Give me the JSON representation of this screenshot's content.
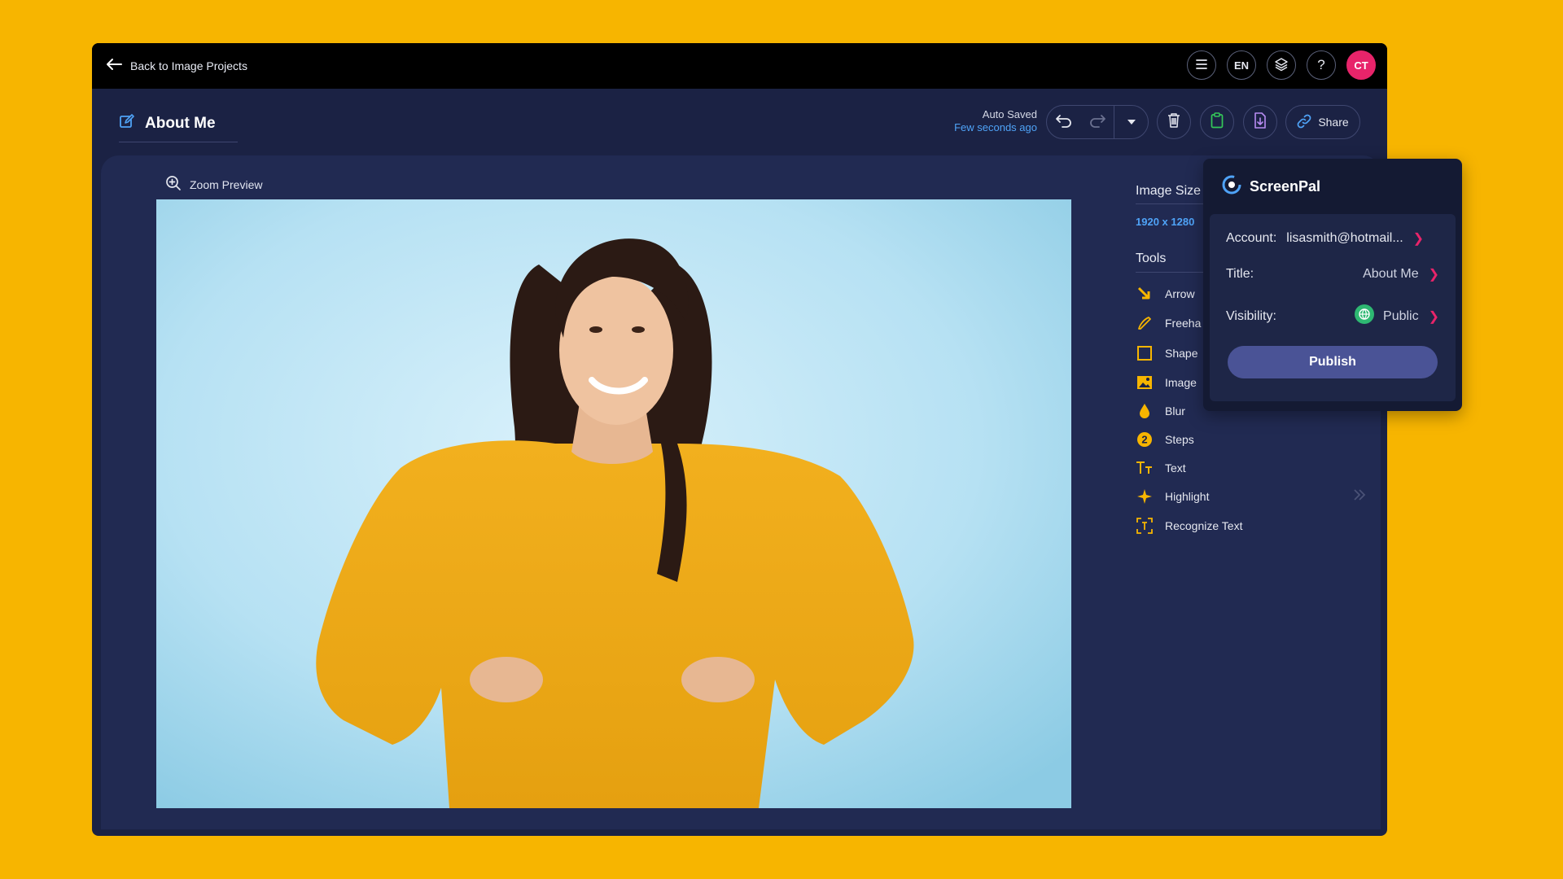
{
  "topbar": {
    "back_label": "Back to Image Projects",
    "lang_label": "EN",
    "help_label": "?",
    "avatar_initials": "CT"
  },
  "document": {
    "title": "About Me",
    "autosave_status": "Auto Saved",
    "autosave_time": "Few seconds ago"
  },
  "toolbar": {
    "share_label": "Share"
  },
  "canvas": {
    "zoom_preview_label": "Zoom Preview"
  },
  "sidebar": {
    "image_size_title": "Image Size",
    "image_size_value": "1920 x 1280",
    "tools_title": "Tools",
    "tools": [
      {
        "label": "Arrow",
        "icon": "arrow-icon"
      },
      {
        "label": "Freeha",
        "icon": "freehand-icon"
      },
      {
        "label": "Shape",
        "icon": "shape-icon"
      },
      {
        "label": "Image",
        "icon": "image-icon"
      },
      {
        "label": "Blur",
        "icon": "blur-drop-icon"
      },
      {
        "label": "Steps",
        "icon": "steps-number-icon"
      },
      {
        "label": "Text",
        "icon": "text-icon"
      },
      {
        "label": "Highlight",
        "icon": "highlight-sparkle-icon"
      },
      {
        "label": "Recognize Text",
        "icon": "recognize-text-icon"
      }
    ]
  },
  "popup": {
    "brand": "ScreenPal",
    "account_label": "Account:",
    "account_value": "lisasmith@hotmail...",
    "title_label": "Title:",
    "title_value": "About Me",
    "visibility_label": "Visibility:",
    "visibility_value": "Public",
    "publish_label": "Publish"
  },
  "colors": {
    "background": "#F7B500",
    "app_bg": "#1B2244",
    "accent_blue": "#4FA3F7",
    "accent_pink": "#E8246A",
    "tool_icon": "#F7B500",
    "publish_button": "#4A5396"
  }
}
